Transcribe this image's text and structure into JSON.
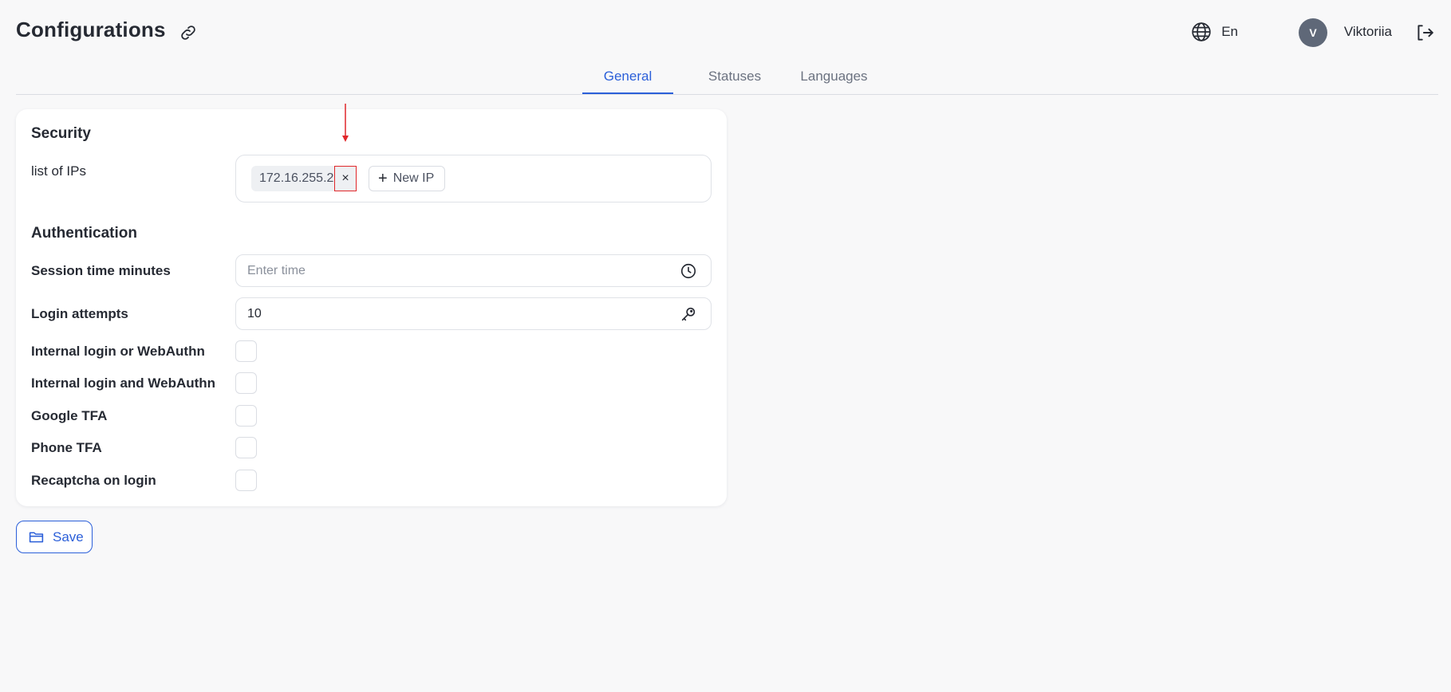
{
  "header": {
    "title": "Configurations",
    "link_icon": "link-icon",
    "language": {
      "icon": "globe-icon",
      "label": "En"
    },
    "user": {
      "avatar_initial": "V",
      "name": "Viktoriia"
    },
    "logout_icon": "logout-icon"
  },
  "tabs": [
    {
      "label": "General",
      "active": true
    },
    {
      "label": "Statuses",
      "active": false
    },
    {
      "label": "Languages",
      "active": false
    }
  ],
  "security": {
    "title": "Security",
    "ip_list_label": "list of IPs",
    "ips": [
      "172.16.255.2"
    ],
    "chip_close_glyph": "×",
    "new_ip_label": "New IP"
  },
  "authentication": {
    "title": "Authentication",
    "session_time": {
      "label": "Session time minutes",
      "value": "",
      "placeholder": "Enter time",
      "icon": "clock-icon"
    },
    "login_attempts": {
      "label": "Login attempts",
      "value": "10",
      "icon": "key-icon"
    },
    "options": [
      {
        "label": "Internal login or WebAuthn",
        "checked": false
      },
      {
        "label": "Internal login and WebAuthn",
        "checked": false
      },
      {
        "label": "Google TFA",
        "checked": false
      },
      {
        "label": "Phone TFA",
        "checked": false
      },
      {
        "label": "Recaptcha on login",
        "checked": false
      }
    ]
  },
  "save": {
    "label": "Save",
    "icon": "folder-icon"
  },
  "colors": {
    "accent": "#2b5fd9",
    "annotation": "#e0272a",
    "avatar_bg": "#5f6878",
    "background": "#f8f8f9"
  }
}
